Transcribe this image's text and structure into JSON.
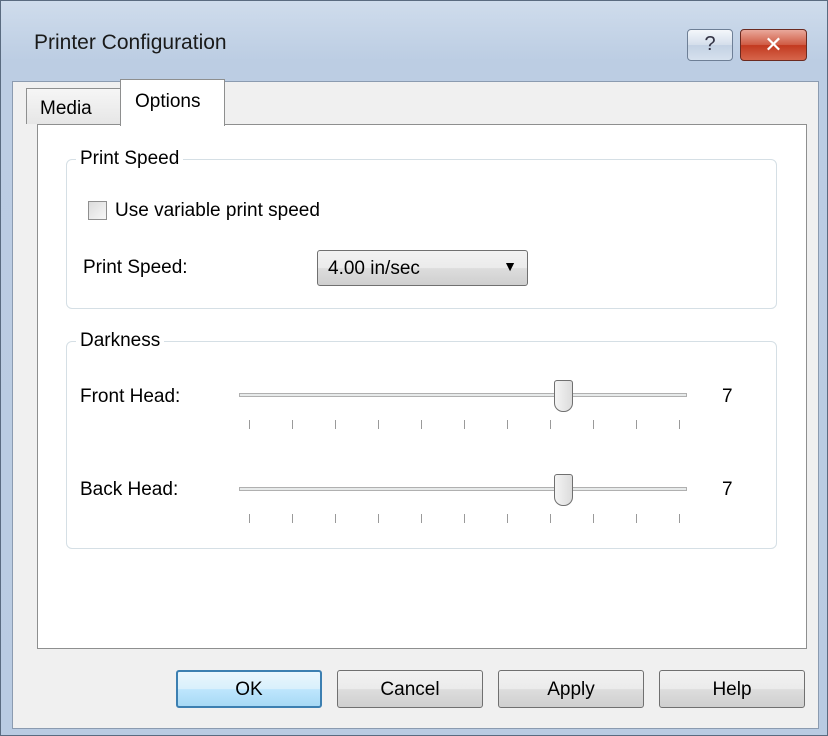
{
  "window": {
    "title": "Printer Configuration"
  },
  "caption": {
    "help_glyph": "?",
    "close_glyph": "✕"
  },
  "tabs": [
    {
      "label": "Media",
      "active": false
    },
    {
      "label": "Options",
      "active": true
    }
  ],
  "print_speed_group": {
    "title": "Print Speed",
    "variable_checkbox": {
      "label": "Use variable print speed",
      "checked": false
    },
    "speed_label": "Print Speed:",
    "speed_value": "4.00 in/sec",
    "dropdown_arrow": "▼"
  },
  "darkness_group": {
    "title": "Darkness",
    "front_head": {
      "label": "Front Head:",
      "value": "7"
    },
    "back_head": {
      "label": "Back Head:",
      "value": "7"
    }
  },
  "buttons": {
    "ok": "OK",
    "cancel": "Cancel",
    "apply": "Apply",
    "help": "Help"
  }
}
